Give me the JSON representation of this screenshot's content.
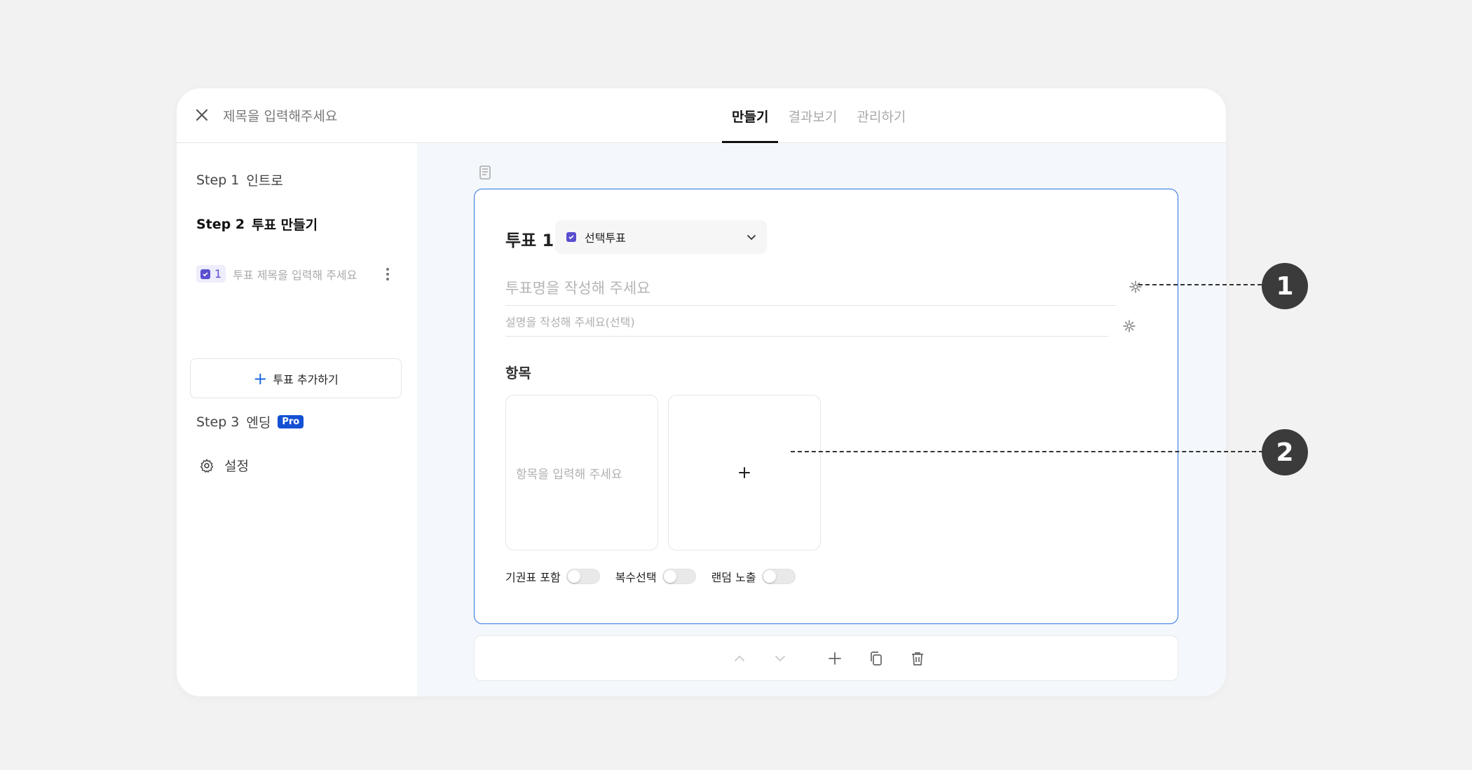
{
  "header": {
    "title_placeholder": "제목을 입력해주세요",
    "tabs": [
      {
        "label": "만들기",
        "active": true
      },
      {
        "label": "결과보기",
        "active": false
      },
      {
        "label": "관리하기",
        "active": false
      }
    ]
  },
  "sidebar": {
    "step1": {
      "num": "Step 1",
      "label": "인트로"
    },
    "step2": {
      "num": "Step 2",
      "label": "투표 만들기"
    },
    "poll_item": {
      "index": "1",
      "label": "투표 제목을 입력해 주세요"
    },
    "add_poll_label": "투표 추가하기",
    "step3": {
      "num": "Step 3",
      "label": "엔딩",
      "badge": "Pro"
    },
    "settings_label": "설정"
  },
  "card": {
    "title": "투표 1",
    "type_select": "선택투표",
    "title_placeholder": "투표명을 작성해 주세요",
    "desc_placeholder": "설명을 작성해 주세요(선택)",
    "options_label": "항목",
    "option_placeholder": "항목을 입력해 주세요",
    "toggles": [
      {
        "label": "기권표 포함",
        "on": false
      },
      {
        "label": "복수선택",
        "on": false
      },
      {
        "label": "랜덤 노출",
        "on": false
      }
    ]
  },
  "callouts": [
    "1",
    "2"
  ],
  "colors": {
    "accent": "#2d74e0",
    "purple": "#5a4fcf",
    "pro_badge": "#1450d4",
    "main_bg": "#f4f8fc",
    "callout": "#3b3b3b"
  }
}
